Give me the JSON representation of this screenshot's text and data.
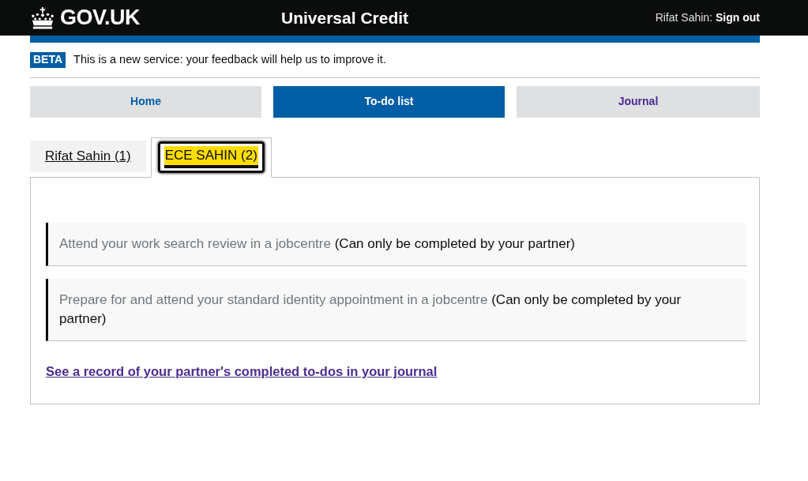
{
  "header": {
    "logo": "GOV.UK",
    "service_name": "Universal Credit",
    "user": "Rifat Sahin:",
    "sign_out": "Sign out"
  },
  "phase_banner": {
    "tag": "BETA",
    "message": "This is a new service: your feedback will help us to improve it."
  },
  "nav": [
    {
      "label": "Home",
      "selected": false,
      "visited": false
    },
    {
      "label": "To-do list",
      "selected": true,
      "visited": false
    },
    {
      "label": "Journal",
      "selected": false,
      "visited": true
    }
  ],
  "tabs": [
    {
      "label": "Rifat Sahin (1)",
      "selected": false,
      "focused": false
    },
    {
      "label": "ECE SAHIN (2)",
      "selected": true,
      "focused": true
    }
  ],
  "todos": [
    {
      "title": "Attend your work search review in a jobcentre",
      "note": "(Can only be completed by your partner)"
    },
    {
      "title": "Prepare for and attend your standard identity appointment in a jobcentre",
      "note": "(Can only be completed by your partner)"
    }
  ],
  "journal_link": "See a record of your partner's completed to-dos in your journal"
}
